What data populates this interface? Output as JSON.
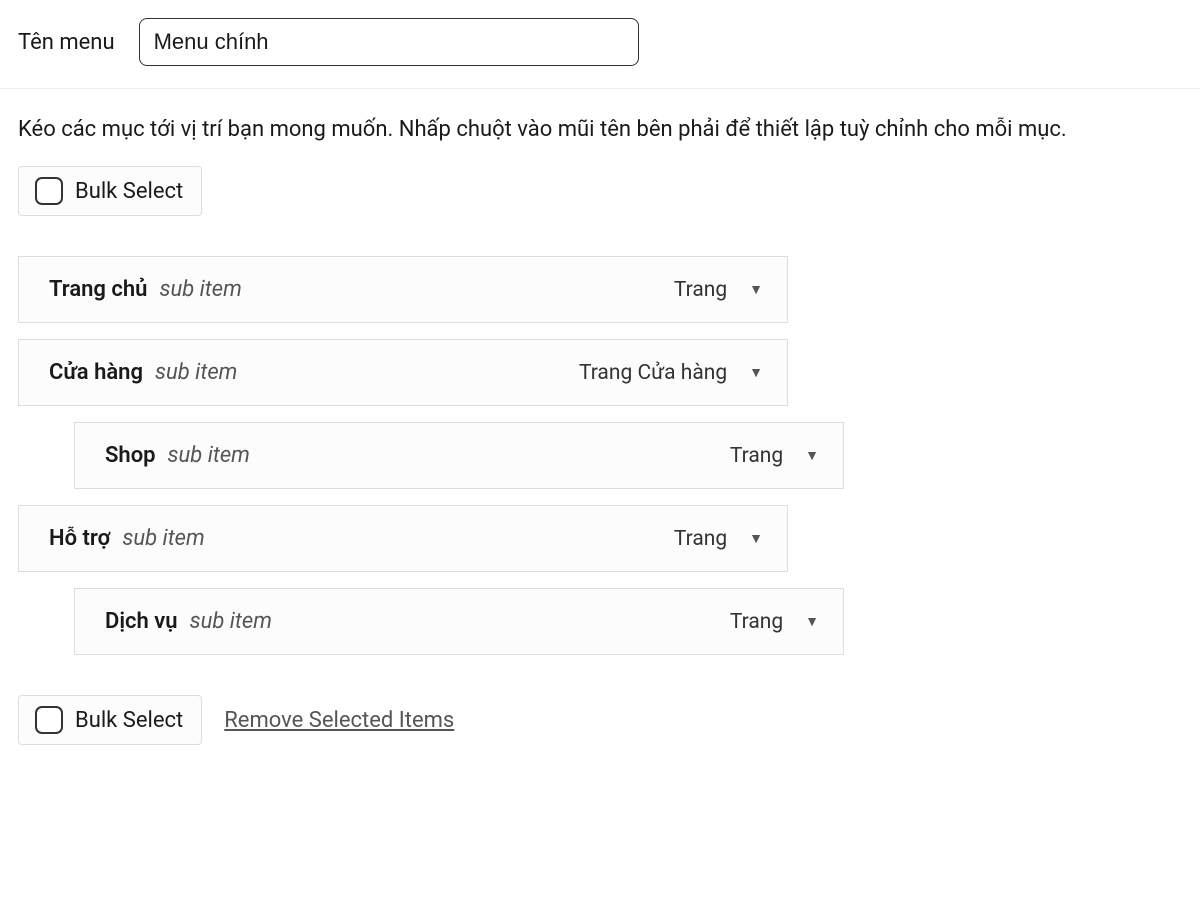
{
  "header": {
    "name_label": "Tên menu",
    "name_value": "Menu chính"
  },
  "instructions": "Kéo các mục tới vị trí bạn mong muốn. Nhấp chuột vào mũi tên bên phải để thiết lập tuỳ chỉnh cho mỗi mục.",
  "bulk_select_label": "Bulk Select",
  "remove_selected_label": "Remove Selected Items",
  "sub_item_label": "sub item",
  "items": [
    {
      "title": "Trang chủ",
      "type": "Trang",
      "nested": false
    },
    {
      "title": "Cửa hàng",
      "type": "Trang Cửa hàng",
      "nested": false
    },
    {
      "title": "Shop",
      "type": "Trang",
      "nested": true
    },
    {
      "title": "Hỗ trợ",
      "type": "Trang",
      "nested": false
    },
    {
      "title": "Dịch vụ",
      "type": "Trang",
      "nested": true
    }
  ]
}
